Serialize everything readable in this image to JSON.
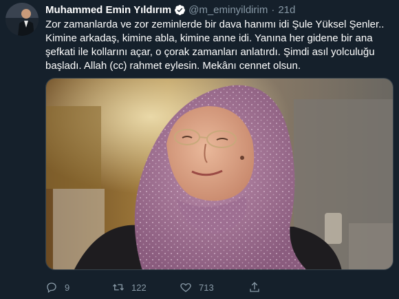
{
  "tweet": {
    "author_name": "Muhammed Emin Yıldırım",
    "handle": "@m_eminyildirim",
    "separator": "·",
    "time": "21d",
    "text_lines": [
      "Zor zamanlarda ve zor zeminlerde bir dava hanımı idi Şule Yüksel Şenler..",
      "Kimine arkadaş, kimine abla, kimine anne idi. Yanına her gidene bir ana",
      "şefkati ile kollarını açar, o çorak zamanları anlatırdı. Şimdi asıl yolculuğu",
      "başladı. Allah (cc) rahmet eylesin. Mekânı cennet olsun."
    ],
    "verified_color": "#ffffff"
  },
  "actions": {
    "reply_count": "9",
    "retweet_count": "122",
    "like_count": "713",
    "icons": [
      "reply-icon",
      "retweet-icon",
      "like-icon",
      "share-icon"
    ]
  },
  "colors": {
    "background": "#15202b",
    "secondary_text": "#8899a6",
    "border": "#38444d"
  }
}
